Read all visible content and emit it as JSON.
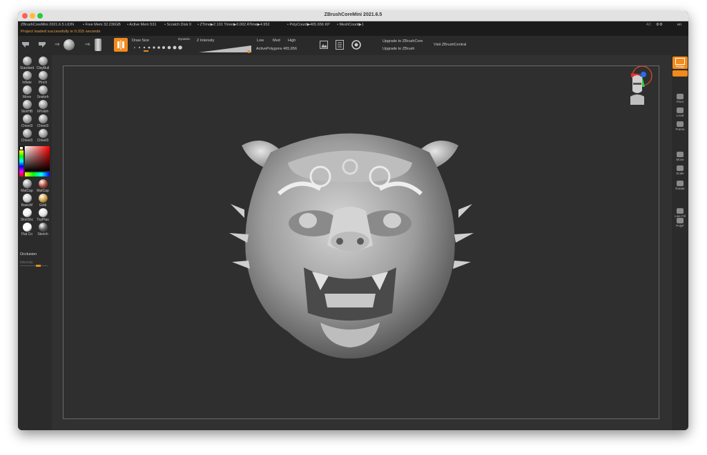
{
  "window": {
    "title": "ZBrushCoreMini 2021.6.5"
  },
  "infobar": {
    "app": "ZBrushCoreMini 2021.6.5 LION",
    "free_mem": "• Free Mem 32.236GB",
    "active_mem": "• Active Mem 531",
    "scratch": "• Scratch Disk 0",
    "ztime": "• ZTime▶2.101 Timer▶0.002 ATime▶4.952",
    "polycount": "• PolyCount▶465.656 KP",
    "meshcount": "• MeshCount▶1",
    "ac": "AC",
    "en": "en"
  },
  "message": "Project loaded successfully in 0.315 seconds",
  "toolbar": {
    "draw_size_label": "Draw Size",
    "dynamic_label": "Dynamic",
    "z_intensity_label": "Z Intensity",
    "low": "Low",
    "med": "Med",
    "high": "High",
    "active_polygons": "ActivePolygons 465,656",
    "upgrade_core": "Upgrade to ZBrushCore",
    "upgrade_zbrush": "Upgrade to ZBrush",
    "visit": "Visit ZBrushCentral",
    "z_intensity_value": 0.95
  },
  "brushes": [
    "Standard",
    "ClayBuil",
    "Inflate",
    "Pinch",
    "Move",
    "Snakeh",
    "SkinHB",
    "hPolish",
    "Chisel3",
    "Chisel3",
    "Chisel3",
    "Chisel3"
  ],
  "materials": [
    {
      "label": "MatCap",
      "color": "#9a9a9a"
    },
    {
      "label": "MatCap",
      "color": "#a8402e"
    },
    {
      "label": "BasicM",
      "color": "#c9c9c9"
    },
    {
      "label": "Gold",
      "color": "#c99a3a"
    },
    {
      "label": "SkinShc",
      "color": "#efefef"
    },
    {
      "label": "ToyPlas",
      "color": "#e0e0e0"
    },
    {
      "label": "Flat Co",
      "color": "#ffffff"
    },
    {
      "label": "Sketch",
      "color": "#555555"
    }
  ],
  "shelf": {
    "occlusion": "Occlusion",
    "intensity": "Intensity"
  },
  "right_buttons": [
    "Persp",
    "Floor",
    "Local",
    "Frame",
    "Move",
    "Scale",
    "Rotate",
    "Line Fill",
    "PolyF"
  ],
  "colors": {
    "accent": "#f28a1c",
    "canvas": "#2f2f2f",
    "ui": "#2b2b2b"
  }
}
